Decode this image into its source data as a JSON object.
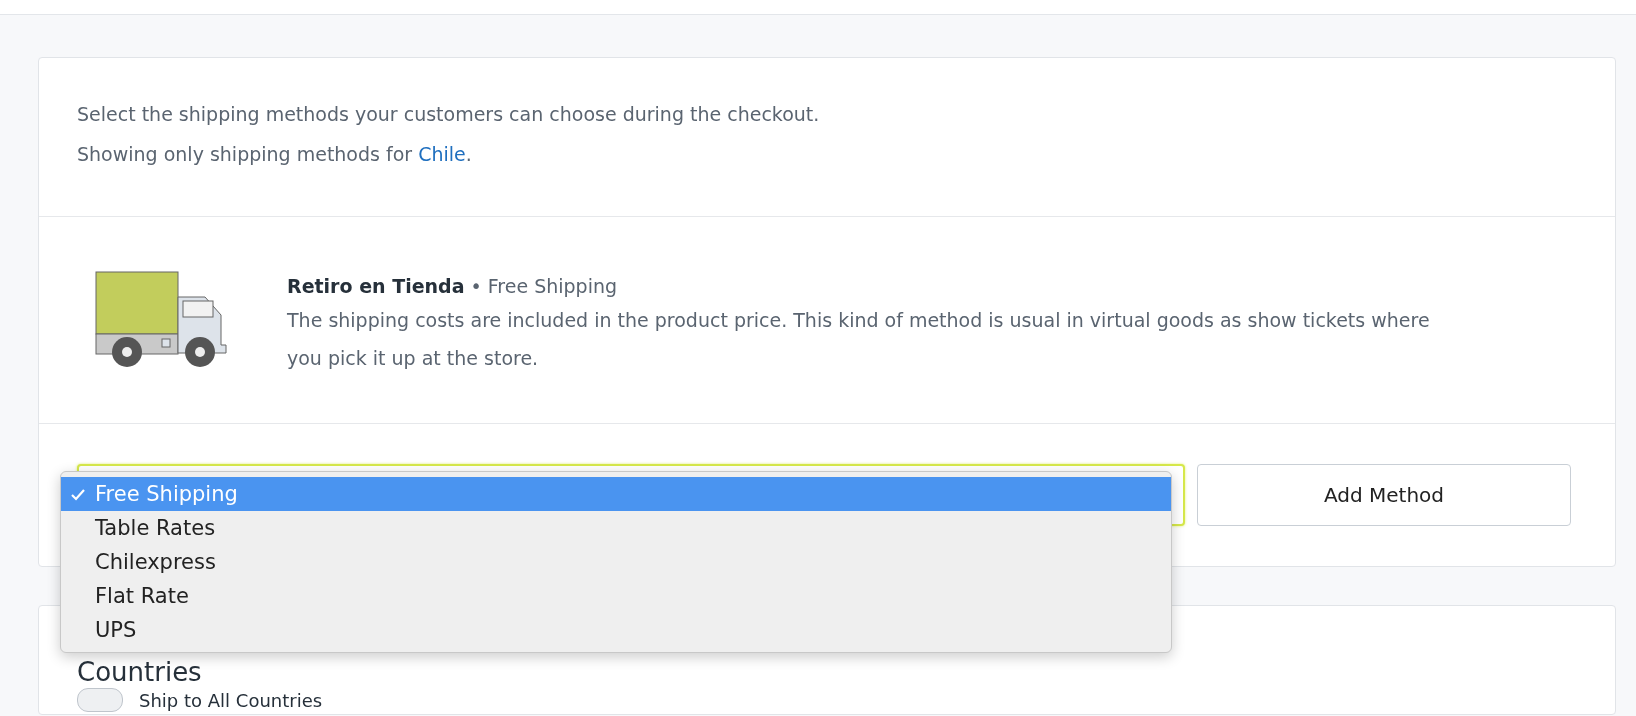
{
  "intro": {
    "line_1": "Select the shipping methods your customers can choose during the checkout.",
    "line_2": "Showing only shipping methods for **Chile**."
  },
  "methods": [
    {
      "name": "Retiro en Tienda",
      "separator": "•",
      "type": "Free Shipping",
      "description": "The shipping costs are included in the product price. This kind of method is usual in virtual goods as show tickets where you pick it up at the store."
    }
  ],
  "add_method": {
    "options": [
      {
        "label": "Free Shipping",
        "selected": true
      },
      {
        "label": "Table Rates",
        "selected": false
      },
      {
        "label": "Chilexpress",
        "selected": false
      },
      {
        "label": "Flat Rate",
        "selected": false
      },
      {
        "label": "UPS",
        "selected": false
      }
    ],
    "button": "Add Method"
  },
  "countries": {
    "title": "Countries",
    "toggle": {
      "label": "Ship to All Countries",
      "on": false
    }
  }
}
